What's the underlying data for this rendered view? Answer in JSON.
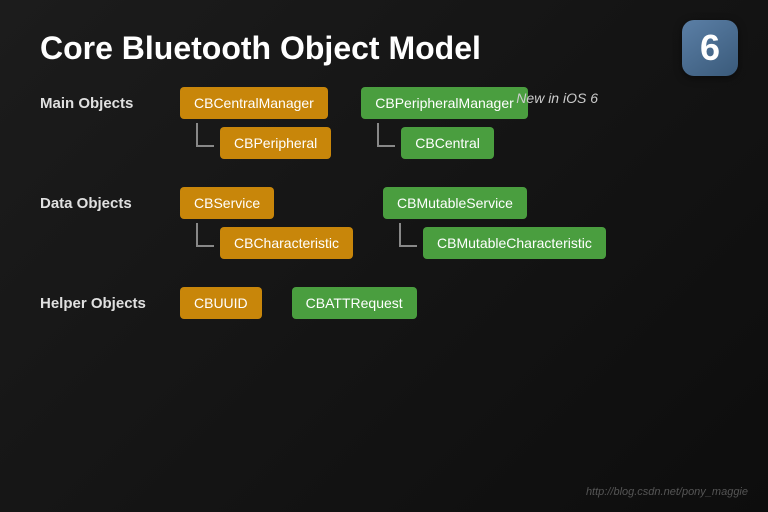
{
  "title": "Core Bluetooth Object Model",
  "ios_badge": "6",
  "new_in_ios_label": "New in iOS 6",
  "watermark": "http://blog.csdn.net/pony_maggie",
  "rows": [
    {
      "id": "main-objects",
      "label": "Main Objects",
      "left": {
        "primary": "CBCentralManager",
        "secondary": "CBPeripheral"
      },
      "right": {
        "primary": "CBPeripheralManager",
        "secondary": "CBCentral"
      }
    },
    {
      "id": "data-objects",
      "label": "Data Objects",
      "left": {
        "primary": "CBService",
        "secondary": "CBCharacteristic"
      },
      "right": {
        "primary": "CBMutableService",
        "secondary": "CBMutableCharacteristic"
      }
    },
    {
      "id": "helper-objects",
      "label": "Helper Objects",
      "left": {
        "primary": "CBUUID",
        "secondary": null
      },
      "right": {
        "primary": "CBATTRequest",
        "secondary": null
      }
    }
  ]
}
